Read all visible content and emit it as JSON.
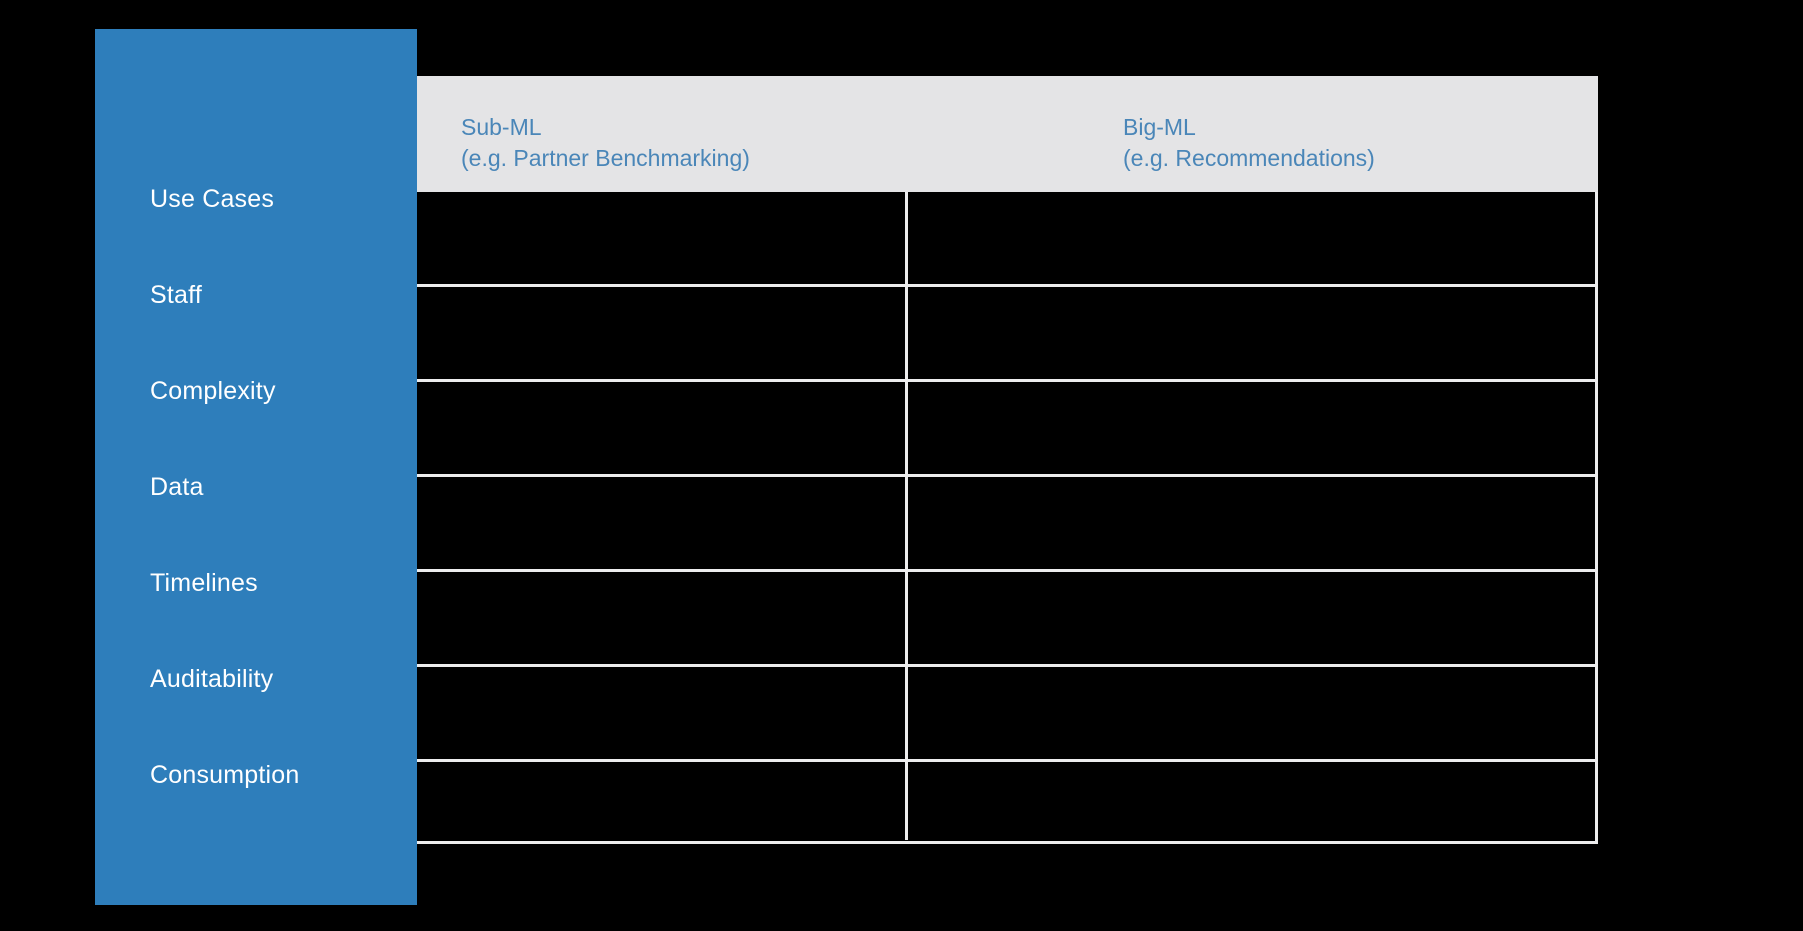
{
  "slide": {
    "background_color": "#000000",
    "sidebar_color": "#2E7EBB",
    "header_band_color": "#E4E4E6",
    "header_text_color": "#4A86B8",
    "gridline_color": "#EDEDEE",
    "sidebar_label_color": "#FFFFFF"
  },
  "sidebar": {
    "rows": [
      {
        "label": "Use Cases"
      },
      {
        "label": "Staff"
      },
      {
        "label": "Complexity"
      },
      {
        "label": "Data"
      },
      {
        "label": "Timelines"
      },
      {
        "label": "Auditability"
      },
      {
        "label": "Consumption"
      }
    ]
  },
  "table": {
    "columns": [
      {
        "title": "Sub-ML",
        "subtitle": "(e.g. Partner Benchmarking)"
      },
      {
        "title": "Big-ML",
        "subtitle": "(e.g. Recommendations)"
      }
    ],
    "rows": [
      {
        "cells": [
          "",
          ""
        ]
      },
      {
        "cells": [
          "",
          ""
        ]
      },
      {
        "cells": [
          "",
          ""
        ]
      },
      {
        "cells": [
          "",
          ""
        ]
      },
      {
        "cells": [
          "",
          ""
        ]
      },
      {
        "cells": [
          "",
          ""
        ]
      },
      {
        "cells": [
          "",
          ""
        ]
      }
    ]
  }
}
